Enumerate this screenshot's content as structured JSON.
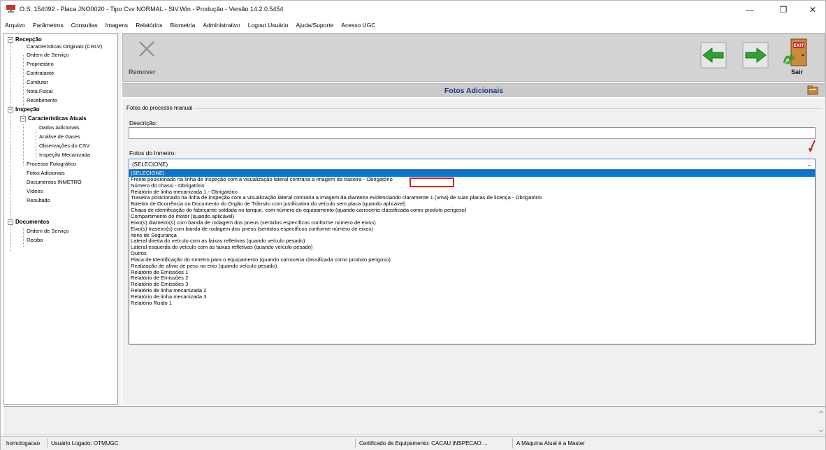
{
  "window": {
    "title": "O.S. 154092 - Placa JNO0020 - Tipo Csv NORMAL - SIV.Win - Produção - Versão 14.2.0.5454",
    "controls": {
      "minimize": "—",
      "maximize": "❐",
      "close": "✕"
    }
  },
  "menu": [
    "Arquivo",
    "Parâmetros",
    "Consultas",
    "Imagens",
    "Relatórios",
    "Biometria",
    "Administrativo",
    "Logout Usuário",
    "Ajuda/Suporte",
    "Acesso UGC"
  ],
  "tree": {
    "recepcao": "Recepção",
    "recepcao_items": [
      "Características Originais (CRLV)",
      "Ordem de Serviço",
      "Proprietário",
      "Contratante",
      "Condutor",
      "Nota Fiscal",
      "Recebimento"
    ],
    "inspecao": "Inspeção",
    "caracteristicas_atuais": "Características Atuais",
    "caracteristicas_items": [
      "Dados Adicionais",
      "Análise de Gases",
      "Observações do CSV",
      "Inspeção Mecanizada"
    ],
    "inspecao_items": [
      "Processo Fotográfico",
      "Fotos Adicionais",
      "Documentos INMETRO",
      "Vídeos",
      "Resultado"
    ],
    "documentos": "Documentos",
    "documentos_items": [
      "Ordem de Serviço",
      "Recibo"
    ]
  },
  "toolbar": {
    "remove_label": "Remover",
    "exit_label": "Sair",
    "exit_sign": "EXIT"
  },
  "section": {
    "title": "Fotos Adicionais"
  },
  "form": {
    "group_label": "Fotos do processo manual",
    "description_label": "Descrição:",
    "description_value": "",
    "inmetro_label": "Fotos do Inmetro:",
    "inmetro_selected": "(SELECIONE)",
    "options": [
      "(SELECIONE)",
      "Frente posicionado na linha de inspeção com a visualização lateral contraria a imagem da traseira - Obrigatório",
      "Número do chassi  - Obrigatório",
      "Relatório de linha mecanizada 1 - Obrigatório",
      "Traseira posicionado na linha de inspeção com a visualização lateral contraria a imagem da dianteira evidenciando claramente 1 (uma) de suas placas de licença - Obrigatório",
      "Boletim de Ocorrência ou Documento do Órgão de Trânsito com justificativa do veículo sem placa (quando aplicável)",
      "Chapa de identificação do fabricante soldada no tanque, com número do equipamento (quando carroceria classificada como produto perigoso)",
      "Compartimento do motor (quando aplicável)",
      "Eixo(s) dianteiro(s) com banda de rodagem dos pneus (sentidos específicos conforme número de eixos)",
      "Eixo(s) traseiro(s) com banda de rodagem dos pneus (sentidos específicos conforme número de eixos)",
      "Itens de Segurança",
      "Lateral direita do veículo com as faixas refletivas (quando veículo pesado)",
      "Lateral esquerda do veículo com as faixas refletivas (quando veículo pesado)",
      "Outros",
      "Placa de Identificação do Inmetro para o equipamento (quando carroceria classificada como produto perigoso)",
      "Realização de alívio de peso no eixo (quando veículo pesado)",
      "Relatório de Emissões 1",
      "Relatório de Emissões 2",
      "Relatório de Emissões 3",
      "Relatório de linha mecanizada 2",
      "Relatório de linha mecanizada 3",
      "Relatório Ruído 1"
    ],
    "highlighted_option_index": 0
  },
  "statusbar": {
    "user_host": "homologacao",
    "logged_user": "Usuário Logado: OTMUGC",
    "certificate": "Certificado de Equipamento: CACAU INSPECAO ...",
    "machine": "A Máquina Atual é a Master"
  },
  "colors": {
    "selection": "#0078d7",
    "header_text": "#1a3a8a",
    "annotation": "#e01b1b",
    "nav_arrow": "#2fa32f"
  }
}
